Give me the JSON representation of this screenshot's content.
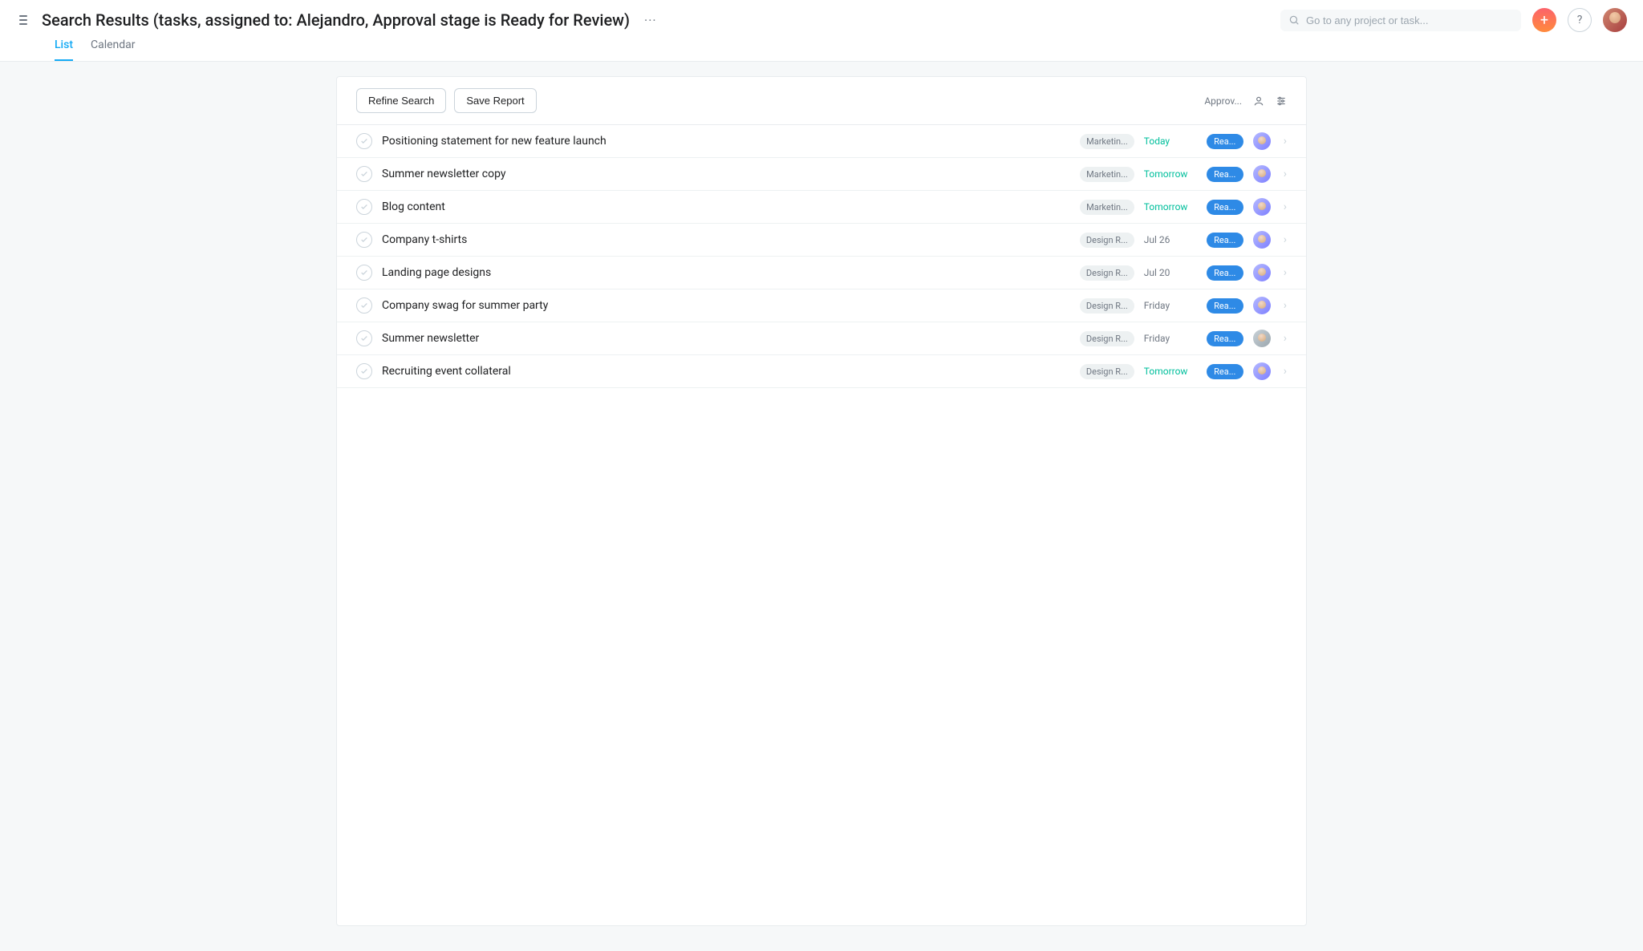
{
  "header": {
    "title": "Search Results (tasks, assigned to: Alejandro, Approval stage is Ready for Review)",
    "search_placeholder": "Go to any project or task...",
    "tabs": [
      {
        "label": "List",
        "active": true
      },
      {
        "label": "Calendar",
        "active": false
      }
    ]
  },
  "toolbar": {
    "refine_label": "Refine Search",
    "save_label": "Save Report",
    "sort_label": "Approv..."
  },
  "status_badge_label": "Rea...",
  "tasks": [
    {
      "name": "Positioning statement for new feature launch",
      "project": "Marketin...",
      "due": "Today",
      "due_class": "today",
      "avatar": "purple"
    },
    {
      "name": "Summer newsletter copy",
      "project": "Marketin...",
      "due": "Tomorrow",
      "due_class": "tomorrow",
      "avatar": "purple"
    },
    {
      "name": "Blog content",
      "project": "Marketin...",
      "due": "Tomorrow",
      "due_class": "tomorrow",
      "avatar": "purple"
    },
    {
      "name": "Company t-shirts",
      "project": "Design R...",
      "due": "Jul 26",
      "due_class": "",
      "avatar": "purple"
    },
    {
      "name": "Landing page designs",
      "project": "Design R...",
      "due": "Jul 20",
      "due_class": "",
      "avatar": "purple"
    },
    {
      "name": "Company swag for summer party",
      "project": "Design R...",
      "due": "Friday",
      "due_class": "",
      "avatar": "purple"
    },
    {
      "name": "Summer newsletter",
      "project": "Design R...",
      "due": "Friday",
      "due_class": "",
      "avatar": "grey"
    },
    {
      "name": "Recruiting event collateral",
      "project": "Design R...",
      "due": "Tomorrow",
      "due_class": "tomorrow",
      "avatar": "purple"
    }
  ]
}
